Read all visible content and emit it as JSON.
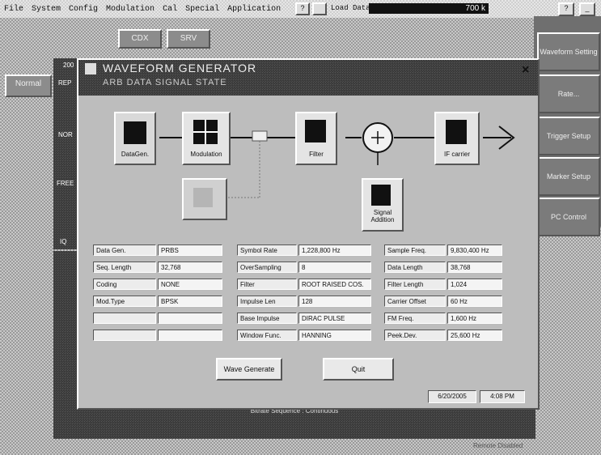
{
  "menu": [
    "File",
    "System",
    "Config",
    "Modulation",
    "Cal",
    "Special",
    "Application"
  ],
  "toolbar": {
    "help_icon_label": "?",
    "load_label": "Load Data Size",
    "load_value": "700 k"
  },
  "top_buttons": [
    "CDX",
    "SRV"
  ],
  "window_controls": [
    "?",
    "_"
  ],
  "left_tab": "Normal",
  "right_panel": [
    "Waveform Setting",
    "Rate...",
    "Trigger Setup",
    "Marker Setup",
    "PC Control"
  ],
  "bg_labels": {
    "year": "200",
    "rep": "REP",
    "nor": "NOR",
    "free": "FREE",
    "iq": "IQ"
  },
  "dialog": {
    "title": "WAVEFORM GENERATOR",
    "subtitle": "ARB DATA SIGNAL STATE",
    "close": "×",
    "blocks": {
      "datagen": "DataGen.",
      "modulation": "Modulation",
      "filter": "Filter",
      "ifcarrier": "IF carrier",
      "signal_addition": "Signal Addition"
    },
    "table": [
      [
        "Data Gen.",
        "PRBS",
        "Symbol Rate",
        "1,228,800 Hz",
        "Sample Freq.",
        "9,830,400 Hz"
      ],
      [
        "Seq. Length",
        "32,768",
        "OverSampling",
        "8",
        "Data Length",
        "38,768"
      ],
      [
        "Coding",
        "NONE",
        "Filter",
        "ROOT RAISED COS.",
        "Filter Length",
        "1,024"
      ],
      [
        "Mod.Type",
        "BPSK",
        "Impulse Len",
        "128",
        "Carrier Offset",
        "60 Hz"
      ],
      [
        "",
        "",
        "Base Impulse",
        "DIRAC PULSE",
        "FM Freq.",
        "1,600 Hz"
      ],
      [
        "",
        "",
        "Window Func.",
        "HANNING",
        "Peek.Dev.",
        "25,600 Hz"
      ]
    ],
    "buttons": {
      "generate": "Wave Generate",
      "quit": "Quit"
    },
    "status": {
      "date": "6/20/2005",
      "time": "4:08 PM"
    }
  },
  "status_bar": "Bitrate Sequence : Continuous",
  "bottom_right": "Remote Disabled"
}
